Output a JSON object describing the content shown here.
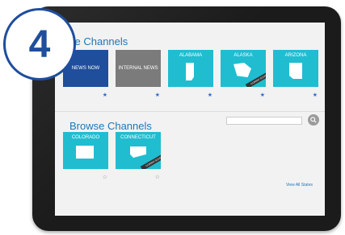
{
  "badge": {
    "number": "4"
  },
  "favorites": {
    "title_visible": "ite Channels",
    "cards": [
      {
        "tile": "NEWS NOW",
        "sub": "",
        "color": "#1f4e9c",
        "starred": true
      },
      {
        "tile": "INTERNAL NEWS",
        "sub": "",
        "color": "#7b7b7b",
        "starred": true
      },
      {
        "tile": "ALABAMA",
        "sub": "",
        "color": "#20bdd0",
        "starred": true
      },
      {
        "tile": "ALASKA",
        "sub": "",
        "color": "#20bdd0",
        "starred": true,
        "ribbon": "COMING SOON"
      },
      {
        "tile": "ARIZONA",
        "sub": "",
        "color": "#20bdd0",
        "starred": true
      }
    ]
  },
  "browse": {
    "title": "Browse Channels",
    "cards": [
      {
        "tile": "COLORADO",
        "sub": "",
        "color": "#20bdd0",
        "starred": false
      },
      {
        "tile": "CONNECTICUT",
        "sub": "",
        "color": "#20bdd0",
        "starred": false,
        "ribbon": "COMING SOON"
      }
    ],
    "view_all": "View All States"
  },
  "search": {
    "icon": "search-icon"
  }
}
